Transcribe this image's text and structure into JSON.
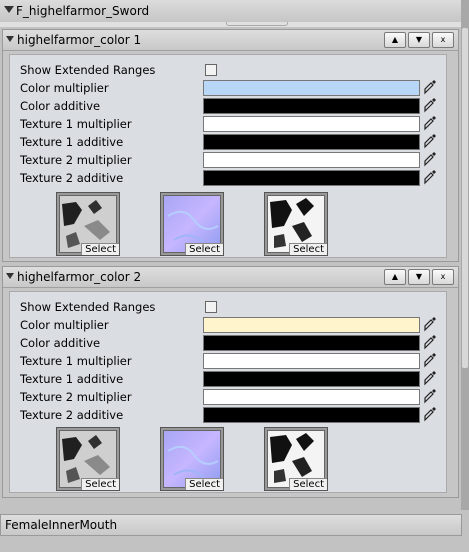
{
  "header": {
    "title": "F_highelfarmor_Sword"
  },
  "panels": [
    {
      "title": "highelfarmor_color 1",
      "show_ext": "Show Extended Ranges",
      "rows": [
        {
          "label": "Color multiplier",
          "color": "#b8d6f6"
        },
        {
          "label": "Color additive",
          "color": "#000000"
        },
        {
          "label": "Texture 1 multiplier",
          "color": "#ffffff"
        },
        {
          "label": "Texture 1 additive",
          "color": "#000000"
        },
        {
          "label": "Texture 2 multiplier",
          "color": "#ffffff"
        },
        {
          "label": "Texture 2 additive",
          "color": "#000000"
        }
      ],
      "select_label": "Select"
    },
    {
      "title": "highelfarmor_color 2",
      "show_ext": "Show Extended Ranges",
      "rows": [
        {
          "label": "Color multiplier",
          "color": "#fff4cc"
        },
        {
          "label": "Color additive",
          "color": "#000000"
        },
        {
          "label": "Texture 1 multiplier",
          "color": "#ffffff"
        },
        {
          "label": "Texture 1 additive",
          "color": "#000000"
        },
        {
          "label": "Texture 2 multiplier",
          "color": "#ffffff"
        },
        {
          "label": "Texture 2 additive",
          "color": "#000000"
        }
      ],
      "select_label": "Select"
    }
  ],
  "buttons": {
    "up": "▲",
    "down": "▼",
    "close": "x"
  },
  "bottom": {
    "title": "FemaleInnerMouth"
  }
}
